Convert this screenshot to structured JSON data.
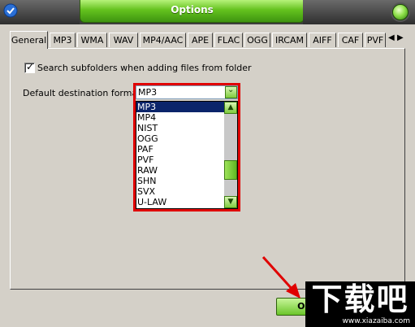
{
  "window": {
    "title": "Options"
  },
  "tabs": [
    {
      "label": "General"
    },
    {
      "label": "MP3"
    },
    {
      "label": "WMA"
    },
    {
      "label": "WAV"
    },
    {
      "label": "MP4/AAC"
    },
    {
      "label": "APE"
    },
    {
      "label": "FLAC"
    },
    {
      "label": "OGG"
    },
    {
      "label": "IRCAM"
    },
    {
      "label": "AIFF"
    },
    {
      "label": "CAF"
    },
    {
      "label": "PVF"
    }
  ],
  "tab_scroll": {
    "left": "◀",
    "right": "▶"
  },
  "general": {
    "search_subfolders_label": "Search subfolders when adding files from folder",
    "search_subfolders_checked": true,
    "default_format_label": "Default destination format",
    "default_format_value": "MP3",
    "format_options": [
      "MP3",
      "MP4",
      "NIST",
      "OGG",
      "PAF",
      "PVF",
      "RAW",
      "SHN",
      "SVX",
      "U-LAW"
    ],
    "selected_option": "MP3"
  },
  "buttons": {
    "ok": "OK"
  },
  "watermark": {
    "mark": "下载吧",
    "url": "www.xiazaiba.com"
  },
  "colors": {
    "accent_green": "#64c21e",
    "highlight_red": "#e00000",
    "selection_blue": "#0a246a",
    "dialog_gray": "#d4d0c8"
  }
}
